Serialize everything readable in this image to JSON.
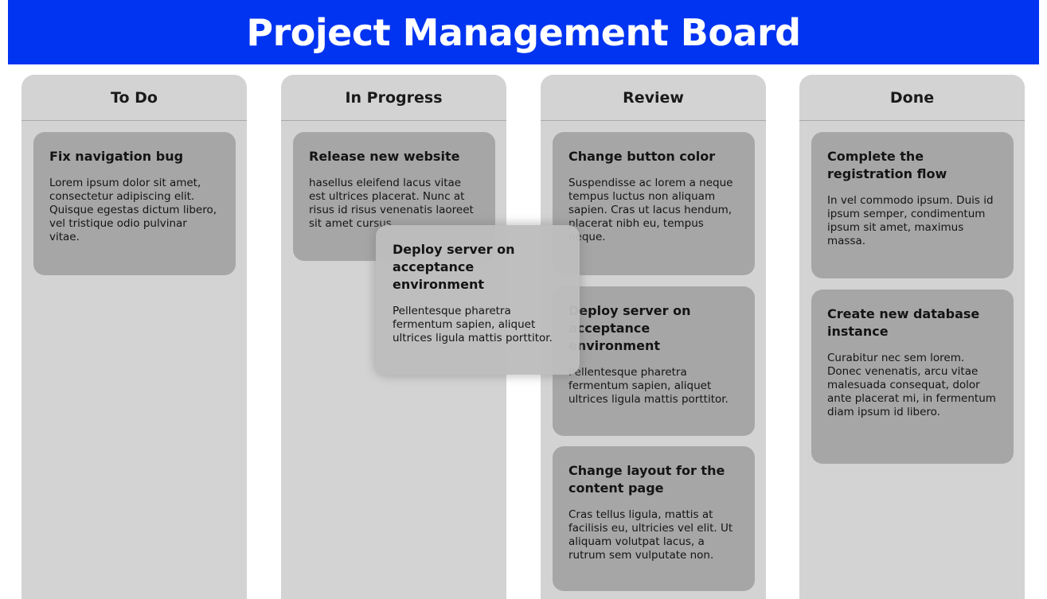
{
  "header": {
    "title": "Project Management Board"
  },
  "columns": [
    {
      "title": "To Do",
      "cards": [
        {
          "title": "Fix navigation bug",
          "body": "Lorem ipsum dolor sit amet, consectetur adipiscing elit. Quisque egestas dictum libero, vel tristique odio pulvinar vitae."
        }
      ]
    },
    {
      "title": "In Progress",
      "cards": [
        {
          "title": "Release new website",
          "body": "hasellus eleifend lacus vitae est ultrices placerat. Nunc at risus id risus venenatis laoreet sit amet cursus"
        }
      ]
    },
    {
      "title": "Review",
      "cards": [
        {
          "title": "Change button color",
          "body": "Suspendisse ac lorem a neque tempus luctus non aliquam sapien. Cras ut lacus hendum, placerat nibh eu, tempus neque."
        },
        {
          "title": "Deploy server on acceptance environment",
          "body": "Pellentesque pharetra fermentum sapien, aliquet ultrices ligula mattis porttitor."
        },
        {
          "title": "Change layout for the content page",
          "body": "Cras tellus ligula, mattis at facilisis eu, ultricies vel elit. Ut aliquam volutpat lacus, a rutrum sem vulputate non."
        }
      ]
    },
    {
      "title": "Done",
      "cards": [
        {
          "title": "Complete the registration flow",
          "body": "In vel commodo ipsum. Duis id ipsum semper, condimentum ipsum sit amet, maximus massa."
        },
        {
          "title": "Create new database instance",
          "body": "Curabitur nec sem lorem. Donec venenatis, arcu vitae malesuada consequat, dolor ante placerat mi, in fermentum diam ipsum id libero."
        }
      ]
    }
  ],
  "dragging_card": {
    "title": "Deploy server on acceptance environment",
    "body": "Pellentesque pharetra fermentum sapien, aliquet ultrices ligula mattis porttitor."
  }
}
